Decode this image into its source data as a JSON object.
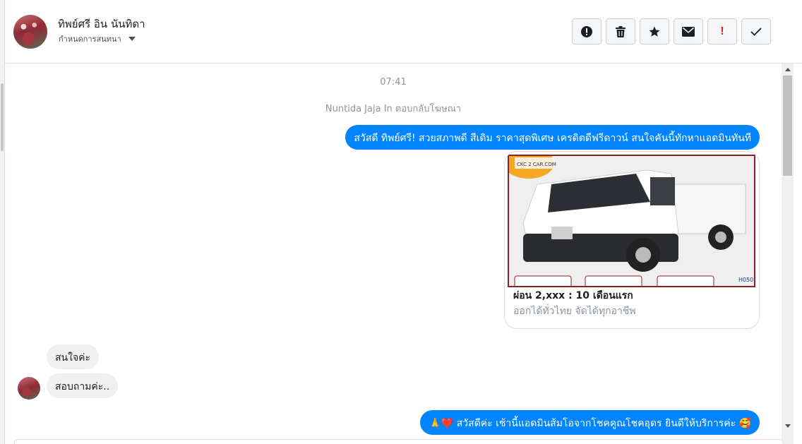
{
  "header": {
    "contact_name": "ทิพย์ศรี อิน นันทิดา",
    "sub_label": "กำหนดการสนทนา"
  },
  "toolbar": {
    "actions": [
      {
        "name": "report-icon"
      },
      {
        "name": "trash-icon"
      },
      {
        "name": "star-icon"
      },
      {
        "name": "envelope-icon"
      },
      {
        "name": "exclamation-icon",
        "glyph": "!",
        "color": "#e41e1e"
      },
      {
        "name": "check-icon"
      }
    ]
  },
  "conversation": {
    "time": "07:41",
    "reply_note": "Nuntida Jaja In ตอบกลับโฆษณา",
    "messages": [
      {
        "direction": "out",
        "text": "สวัสดี ทิพย์ศรี! สวยสภาพดี สีเดิม ราคาสุดพิเศษ เครดิตดีฟรีดาวน์  สนใจคันนี้ทักหาแอดมินทันที"
      },
      {
        "direction": "out",
        "type": "card",
        "title": "ผ่อน 2,xxx : 10 เดือนแรก",
        "subtitle": "ออกได้ทั่วไทย จัดได้ทุกอาชีพ",
        "image_logo_text": "CKC 2 CAR.COM",
        "image_tag": "H050"
      },
      {
        "direction": "in",
        "text": "สนใจค่ะ"
      },
      {
        "direction": "in",
        "text": "สอบถามค่ะ.."
      },
      {
        "direction": "out",
        "text": "สวัสดีค่ะ เช้านี้แอดมินส้มโอจากโชคคูณโชคอุดร ยินดีให้บริการค่ะ",
        "prefix_emoji": "🙏❤️",
        "suffix_emoji": "🥰"
      }
    ]
  },
  "colors": {
    "accent": "#0084ff",
    "incoming_bubble": "#f1f0f0",
    "card_border": "#8c1f28"
  }
}
